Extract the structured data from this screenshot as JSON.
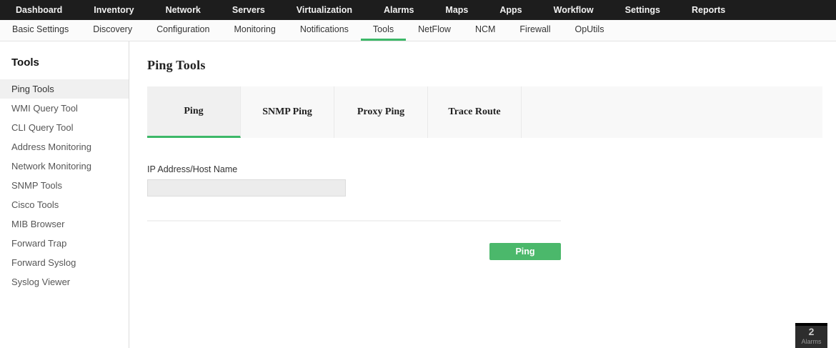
{
  "topnav": {
    "items": [
      "Dashboard",
      "Inventory",
      "Network",
      "Servers",
      "Virtualization",
      "Alarms",
      "Maps",
      "Apps",
      "Workflow",
      "Settings",
      "Reports"
    ]
  },
  "subnav": {
    "items": [
      "Basic Settings",
      "Discovery",
      "Configuration",
      "Monitoring",
      "Notifications",
      "Tools",
      "NetFlow",
      "NCM",
      "Firewall",
      "OpUtils"
    ],
    "active": "Tools"
  },
  "sidebar": {
    "title": "Tools",
    "items": [
      "Ping Tools",
      "WMI Query Tool",
      "CLI Query Tool",
      "Address Monitoring",
      "Network Monitoring",
      "SNMP Tools",
      "Cisco Tools",
      "MIB Browser",
      "Forward Trap",
      "Forward Syslog",
      "Syslog Viewer"
    ],
    "active": "Ping Tools"
  },
  "main": {
    "title": "Ping Tools",
    "tabs": [
      "Ping",
      "SNMP Ping",
      "Proxy Ping",
      "Trace Route"
    ],
    "active_tab": "Ping",
    "form": {
      "ip_label": "IP Address/Host Name",
      "ip_value": "",
      "ping_button": "Ping"
    }
  },
  "alarms_badge": {
    "count": "2",
    "label": "Alarms"
  },
  "colors": {
    "accent_green": "#3db868",
    "button_green": "#4bb86b",
    "topbar_bg": "#1d1d1d"
  }
}
